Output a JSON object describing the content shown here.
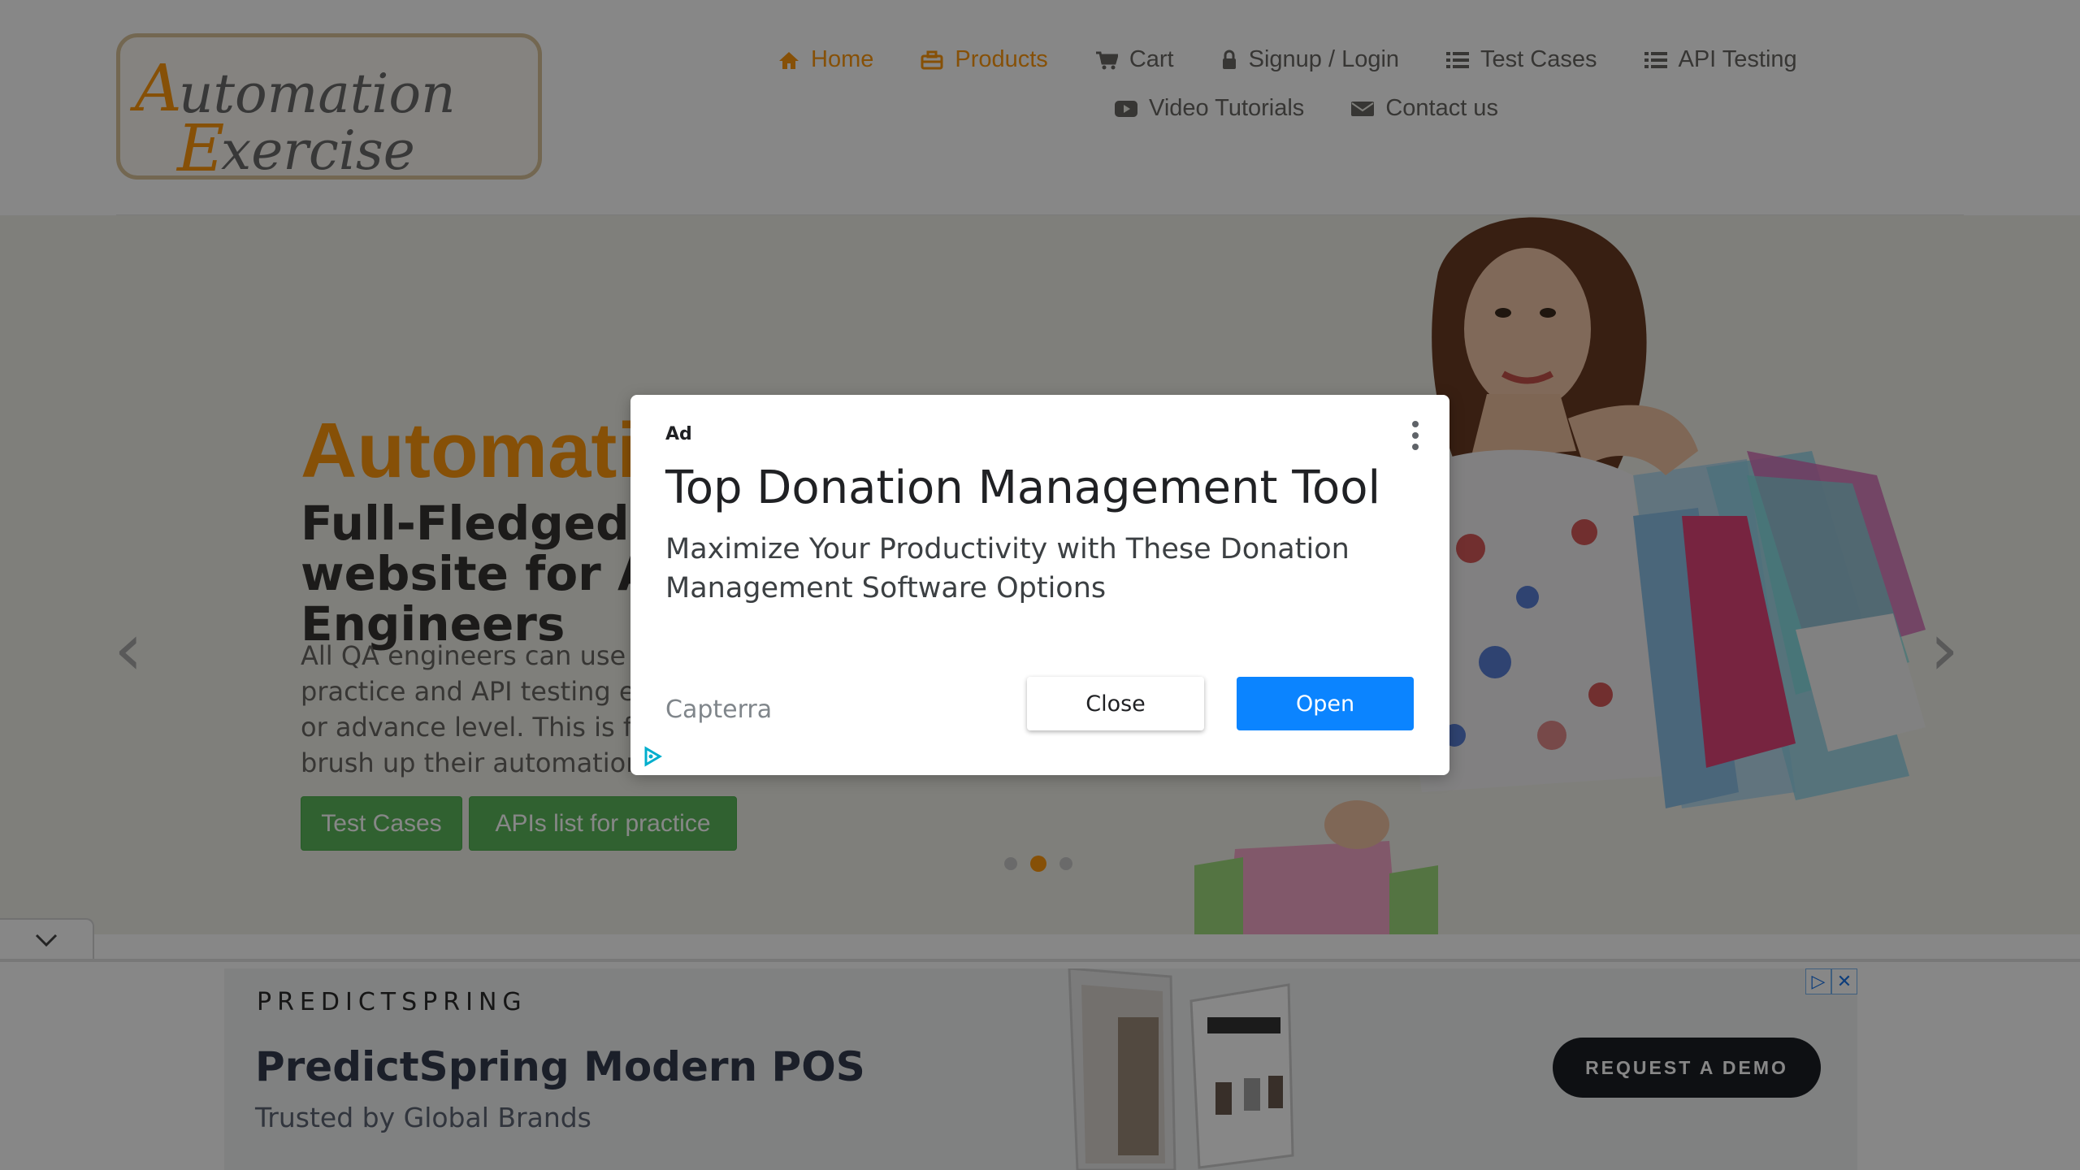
{
  "logo": {
    "line1": "Automation",
    "line2": "Exercise"
  },
  "nav": {
    "row1": [
      {
        "label": "Home",
        "icon": "home-icon",
        "active": true
      },
      {
        "label": "Products",
        "icon": "briefcase-icon",
        "active": true
      },
      {
        "label": "Cart",
        "icon": "cart-icon",
        "active": false
      },
      {
        "label": "Signup / Login",
        "icon": "lock-icon",
        "active": false
      },
      {
        "label": "Test Cases",
        "icon": "list-icon",
        "active": false
      },
      {
        "label": "API Testing",
        "icon": "list-icon",
        "active": false
      }
    ],
    "row2": [
      {
        "label": "Video Tutorials",
        "icon": "youtube-icon"
      },
      {
        "label": "Contact us",
        "icon": "envelope-icon"
      }
    ]
  },
  "hero": {
    "title": "AutomationExercise",
    "subtitle": "Full-Fledged practice website for Automation Engineers",
    "description": "All QA engineers can use this website for automation practice and API testing either they are at beginner or advance level. This is for everybody to help them brush up their automation skills.",
    "buttons": {
      "test_cases": "Test Cases",
      "apis": "APIs list for practice"
    },
    "prev_arrow": "‹",
    "next_arrow": "›",
    "active_slide": 1,
    "slide_count": 3
  },
  "bottom_ad": {
    "brand": "PREDICTSPRING",
    "title": "PredictSpring Modern POS",
    "subtitle": "Trusted by Global Brands",
    "cta": "REQUEST A DEMO"
  },
  "modal_ad": {
    "label": "Ad",
    "title": "Top Donation Management Tool",
    "description": "Maximize Your Productivity with These Donation Management Software Options",
    "advertiser": "Capterra",
    "close_label": "Close",
    "open_label": "Open"
  },
  "colors": {
    "accent": "#fe980f",
    "green": "#5cb85c",
    "blue": "#0b84ff"
  }
}
